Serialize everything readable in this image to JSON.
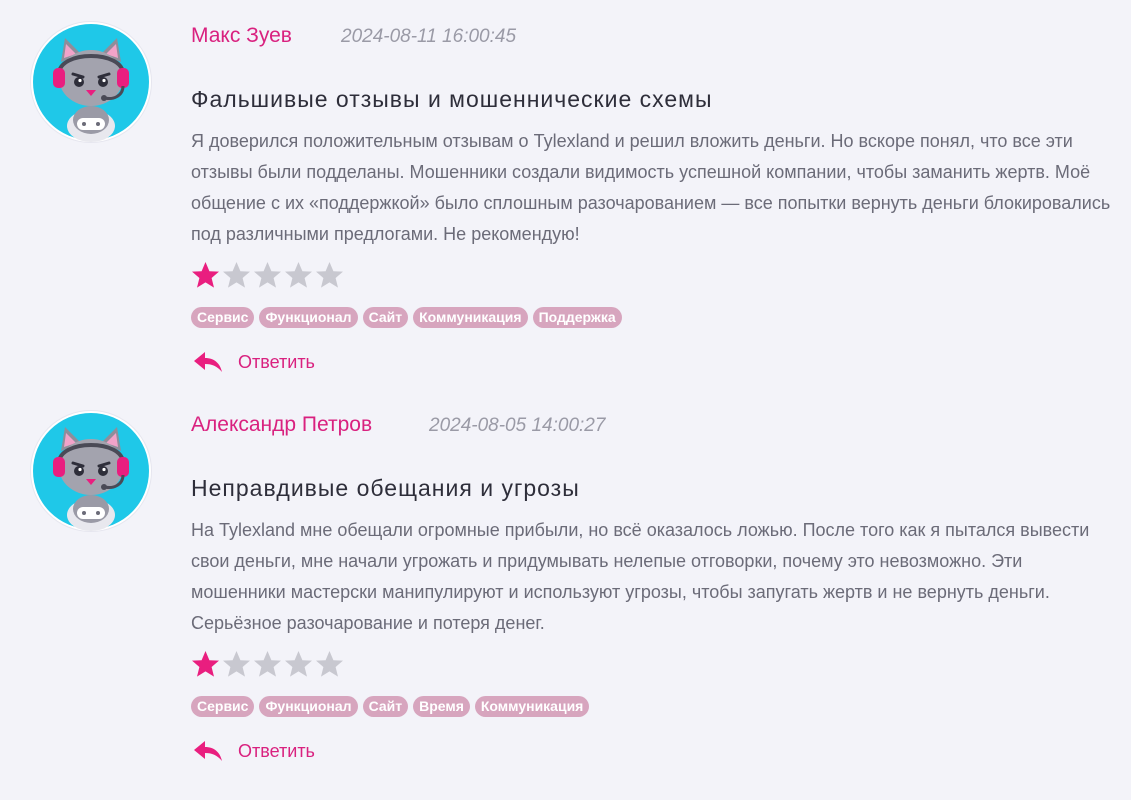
{
  "reviews": [
    {
      "author": "Макс Зуев",
      "date": "2024-08-11 16:00:45",
      "title": "Фальшивые отзывы и мошеннические схемы",
      "text": "Я доверился положительным отзывам о Tylexland и решил вложить деньги. Но вскоре понял, что все эти отзывы были подделаны. Мошенники создали видимость успешной компании, чтобы заманить жертв. Моё общение с их «поддержкой» было сплошным разочарованием — все попытки вернуть деньги блокировались под различными предлогами. Не рекомендую!",
      "rating": 1,
      "rating_max": 5,
      "tags": [
        "Сервис",
        "Функционал",
        "Сайт",
        "Коммуникация",
        "Поддержка"
      ],
      "reply_label": "Ответить"
    },
    {
      "author": "Александр Петров",
      "date": "2024-08-05 14:00:27",
      "title": "Неправдивые обещания и угрозы",
      "text": "На Tylexland мне обещали огромные прибыли, но всё оказалось ложью. После того как я пытался вывести свои деньги, мне начали угрожать и придумывать нелепые отговорки, почему это невозможно. Эти мошенники мастерски манипулируют и используют угрозы, чтобы запугать жертв и не вернуть деньги. Серьёзное разочарование и потеря денег.",
      "rating": 1,
      "rating_max": 5,
      "tags": [
        "Сервис",
        "Функционал",
        "Сайт",
        "Время",
        "Коммуникация"
      ],
      "reply_label": "Ответить"
    }
  ],
  "colors": {
    "accent": "#d9217f",
    "star_filled": "#e91e7f",
    "star_empty": "#c8c8d0",
    "tag_bg": "#d7a5be",
    "background": "#f3f3f9",
    "avatar_ring": "#1fc8e8"
  },
  "icons": {
    "avatar": "cat-gamer-avatar-icon",
    "star": "star-icon",
    "reply": "reply-arrow-icon"
  }
}
